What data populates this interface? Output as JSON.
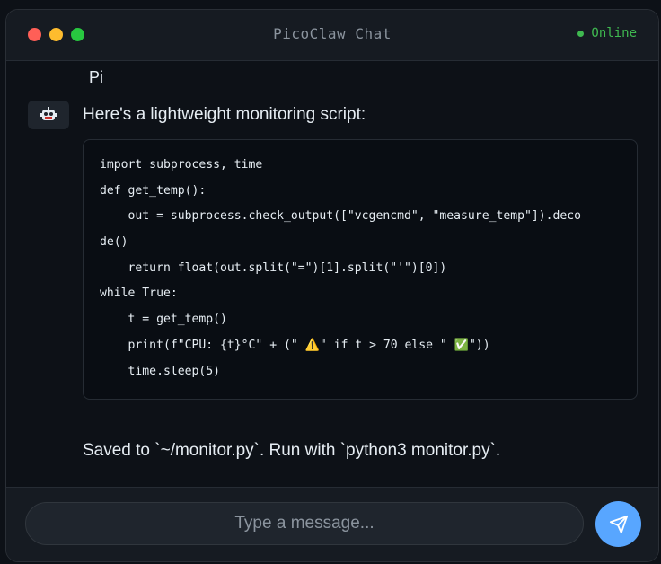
{
  "window": {
    "title": "PicoClaw Chat",
    "status": "Online"
  },
  "messages": {
    "previous_text": "Pi",
    "assistant": {
      "avatar_icon": "robot-icon",
      "intro": "Here's a lightweight monitoring script:",
      "code_lines": [
        "import subprocess, time",
        "def get_temp():",
        "    out = subprocess.check_output([\"vcgencmd\", \"measure_temp\"]).deco",
        "de()",
        "    return float(out.split(\"=\")[1].split(\"'\")[0])",
        "while True:",
        "    t = get_temp()",
        "    print(f\"CPU: {t}°C\" + (\" ⚠️\" if t > 70 else \" ✅\"))",
        "    time.sleep(5)"
      ],
      "followup": "Saved to `~/monitor.py`. Run with `python3 monitor.py`."
    }
  },
  "composer": {
    "placeholder": "Type a message...",
    "send_icon": "send-icon"
  },
  "colors": {
    "background": "#0d1117",
    "accent": "#58a6ff",
    "online": "#3fb950"
  }
}
